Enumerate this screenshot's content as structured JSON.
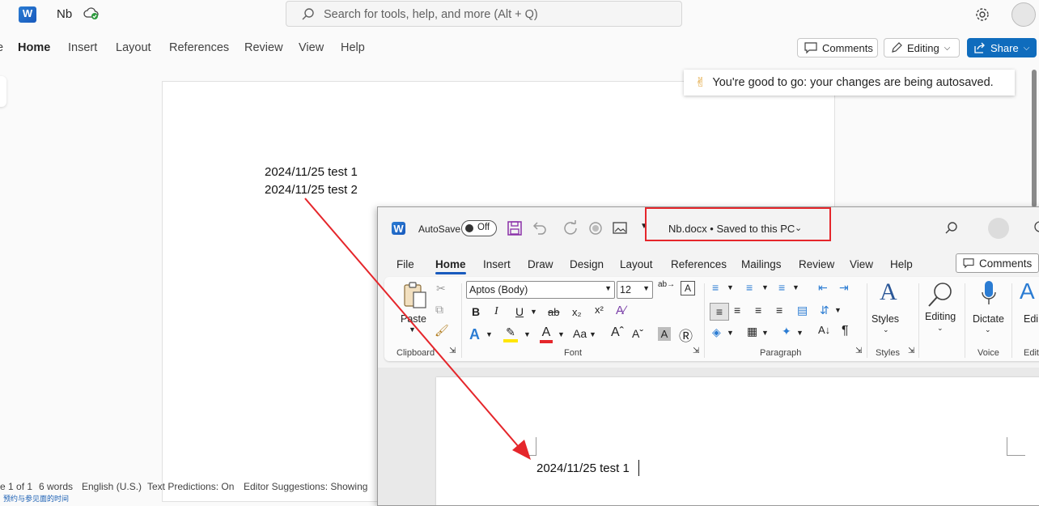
{
  "web": {
    "doc_name": "Nb",
    "search_placeholder": "Search for tools, help, and more (Alt + Q)",
    "tabs": [
      "e",
      "Home",
      "Insert",
      "Layout",
      "References",
      "Review",
      "View",
      "Help"
    ],
    "active_tab": "Home",
    "comments_label": "Comments",
    "editing_label": "Editing",
    "share_label": "Share",
    "toast_text": "You're good to go: your changes are being autosaved.",
    "doc_lines": [
      "2024/11/25 test 1",
      "2024/11/25 test 2"
    ],
    "status": {
      "page": "e 1 of 1",
      "words": "6 words",
      "language": "English (U.S.)",
      "text_predictions": "Text Predictions: On",
      "editor": "Editor Suggestions: Showing"
    },
    "taskbar_text": "预约与参见面的时间"
  },
  "desktop": {
    "autosave_label": "AutoSave",
    "autosave_state": "Off",
    "file_title": "Nb.docx • Saved to this PC",
    "tabs": [
      "File",
      "Home",
      "Insert",
      "Draw",
      "Design",
      "Layout",
      "References",
      "Mailings",
      "Review",
      "View",
      "Help"
    ],
    "active_tab": "Home",
    "comments_label": "Comments",
    "ribbon": {
      "paste_label": "Paste",
      "font_name": "Aptos (Body)",
      "font_size": "12",
      "case_label": "Aa",
      "styles_label": "Styles",
      "editing_label": "Editing",
      "dictate_label": "Dictate",
      "edit_partial": "Edi",
      "groups": {
        "clipboard": "Clipboard",
        "font": "Font",
        "paragraph": "Paragraph",
        "styles": "Styles",
        "voice": "Voice",
        "edit_partial": "Edit"
      }
    },
    "doc_line": "2024/11/25 test 1"
  },
  "colors": {
    "annotation_red": "#e5262b",
    "word_blue": "#185abd",
    "share_blue": "#0f6cbd"
  }
}
